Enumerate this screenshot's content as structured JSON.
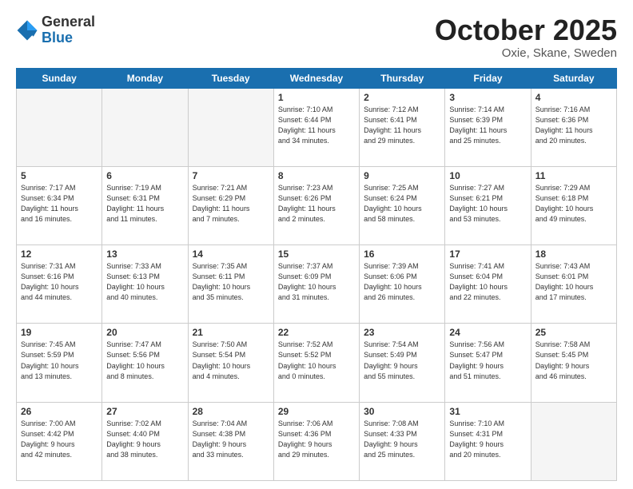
{
  "header": {
    "logo_general": "General",
    "logo_blue": "Blue",
    "month": "October 2025",
    "location": "Oxie, Skane, Sweden"
  },
  "days_of_week": [
    "Sunday",
    "Monday",
    "Tuesday",
    "Wednesday",
    "Thursday",
    "Friday",
    "Saturday"
  ],
  "weeks": [
    [
      {
        "num": "",
        "info": ""
      },
      {
        "num": "",
        "info": ""
      },
      {
        "num": "",
        "info": ""
      },
      {
        "num": "1",
        "info": "Sunrise: 7:10 AM\nSunset: 6:44 PM\nDaylight: 11 hours\nand 34 minutes."
      },
      {
        "num": "2",
        "info": "Sunrise: 7:12 AM\nSunset: 6:41 PM\nDaylight: 11 hours\nand 29 minutes."
      },
      {
        "num": "3",
        "info": "Sunrise: 7:14 AM\nSunset: 6:39 PM\nDaylight: 11 hours\nand 25 minutes."
      },
      {
        "num": "4",
        "info": "Sunrise: 7:16 AM\nSunset: 6:36 PM\nDaylight: 11 hours\nand 20 minutes."
      }
    ],
    [
      {
        "num": "5",
        "info": "Sunrise: 7:17 AM\nSunset: 6:34 PM\nDaylight: 11 hours\nand 16 minutes."
      },
      {
        "num": "6",
        "info": "Sunrise: 7:19 AM\nSunset: 6:31 PM\nDaylight: 11 hours\nand 11 minutes."
      },
      {
        "num": "7",
        "info": "Sunrise: 7:21 AM\nSunset: 6:29 PM\nDaylight: 11 hours\nand 7 minutes."
      },
      {
        "num": "8",
        "info": "Sunrise: 7:23 AM\nSunset: 6:26 PM\nDaylight: 11 hours\nand 2 minutes."
      },
      {
        "num": "9",
        "info": "Sunrise: 7:25 AM\nSunset: 6:24 PM\nDaylight: 10 hours\nand 58 minutes."
      },
      {
        "num": "10",
        "info": "Sunrise: 7:27 AM\nSunset: 6:21 PM\nDaylight: 10 hours\nand 53 minutes."
      },
      {
        "num": "11",
        "info": "Sunrise: 7:29 AM\nSunset: 6:18 PM\nDaylight: 10 hours\nand 49 minutes."
      }
    ],
    [
      {
        "num": "12",
        "info": "Sunrise: 7:31 AM\nSunset: 6:16 PM\nDaylight: 10 hours\nand 44 minutes."
      },
      {
        "num": "13",
        "info": "Sunrise: 7:33 AM\nSunset: 6:13 PM\nDaylight: 10 hours\nand 40 minutes."
      },
      {
        "num": "14",
        "info": "Sunrise: 7:35 AM\nSunset: 6:11 PM\nDaylight: 10 hours\nand 35 minutes."
      },
      {
        "num": "15",
        "info": "Sunrise: 7:37 AM\nSunset: 6:09 PM\nDaylight: 10 hours\nand 31 minutes."
      },
      {
        "num": "16",
        "info": "Sunrise: 7:39 AM\nSunset: 6:06 PM\nDaylight: 10 hours\nand 26 minutes."
      },
      {
        "num": "17",
        "info": "Sunrise: 7:41 AM\nSunset: 6:04 PM\nDaylight: 10 hours\nand 22 minutes."
      },
      {
        "num": "18",
        "info": "Sunrise: 7:43 AM\nSunset: 6:01 PM\nDaylight: 10 hours\nand 17 minutes."
      }
    ],
    [
      {
        "num": "19",
        "info": "Sunrise: 7:45 AM\nSunset: 5:59 PM\nDaylight: 10 hours\nand 13 minutes."
      },
      {
        "num": "20",
        "info": "Sunrise: 7:47 AM\nSunset: 5:56 PM\nDaylight: 10 hours\nand 8 minutes."
      },
      {
        "num": "21",
        "info": "Sunrise: 7:50 AM\nSunset: 5:54 PM\nDaylight: 10 hours\nand 4 minutes."
      },
      {
        "num": "22",
        "info": "Sunrise: 7:52 AM\nSunset: 5:52 PM\nDaylight: 10 hours\nand 0 minutes."
      },
      {
        "num": "23",
        "info": "Sunrise: 7:54 AM\nSunset: 5:49 PM\nDaylight: 9 hours\nand 55 minutes."
      },
      {
        "num": "24",
        "info": "Sunrise: 7:56 AM\nSunset: 5:47 PM\nDaylight: 9 hours\nand 51 minutes."
      },
      {
        "num": "25",
        "info": "Sunrise: 7:58 AM\nSunset: 5:45 PM\nDaylight: 9 hours\nand 46 minutes."
      }
    ],
    [
      {
        "num": "26",
        "info": "Sunrise: 7:00 AM\nSunset: 4:42 PM\nDaylight: 9 hours\nand 42 minutes."
      },
      {
        "num": "27",
        "info": "Sunrise: 7:02 AM\nSunset: 4:40 PM\nDaylight: 9 hours\nand 38 minutes."
      },
      {
        "num": "28",
        "info": "Sunrise: 7:04 AM\nSunset: 4:38 PM\nDaylight: 9 hours\nand 33 minutes."
      },
      {
        "num": "29",
        "info": "Sunrise: 7:06 AM\nSunset: 4:36 PM\nDaylight: 9 hours\nand 29 minutes."
      },
      {
        "num": "30",
        "info": "Sunrise: 7:08 AM\nSunset: 4:33 PM\nDaylight: 9 hours\nand 25 minutes."
      },
      {
        "num": "31",
        "info": "Sunrise: 7:10 AM\nSunset: 4:31 PM\nDaylight: 9 hours\nand 20 minutes."
      },
      {
        "num": "",
        "info": ""
      }
    ]
  ]
}
